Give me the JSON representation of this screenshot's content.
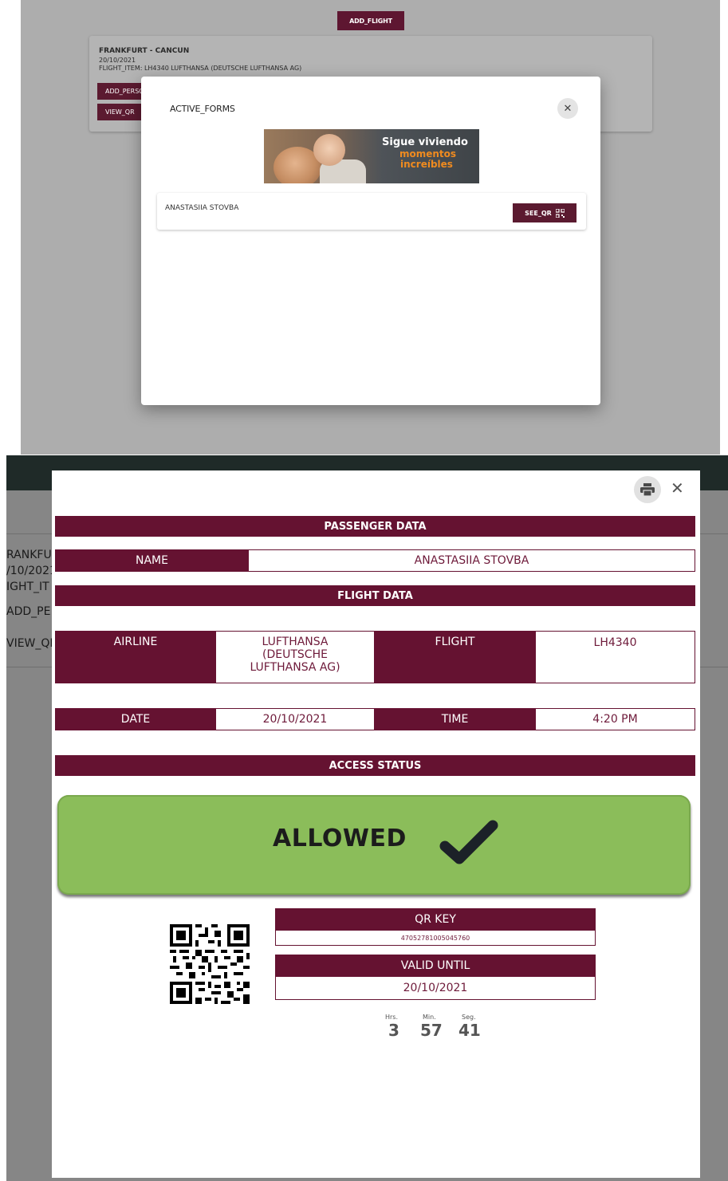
{
  "panel1": {
    "add_flight_label": "ADD_FLIGHT",
    "card": {
      "route": "FRANKFURT - CANCUN",
      "date": "20/10/2021",
      "flight_item": "FLIGHT_ITEM: LH4340 LUFTHANSA (DEUTSCHE LUFTHANSA AG)",
      "add_person_label": "ADD_PERSON",
      "view_qr_label": "VIEW_QR"
    },
    "modal": {
      "title": "ACTIVE_FORMS",
      "close_icon": "close-icon",
      "banner": {
        "line1": "Sigue viviendo",
        "line2": "momentos",
        "line3": "increíbles"
      },
      "form_row": {
        "passenger": "ANASTASIIA STOVBA",
        "see_qr_label": "SEE_QR",
        "qr_icon": "qr-code-icon"
      }
    }
  },
  "panel2": {
    "background_card": {
      "route_fragment": "RANKFU",
      "date_fragment": "/10/2021",
      "item_fragment": "IGHT_IT",
      "add_person_fragment": "ADD_PE",
      "view_qr_fragment": "VIEW_QF"
    },
    "modal": {
      "print_icon": "print-icon",
      "close_icon": "close-icon",
      "passenger_section": "PASSENGER DATA",
      "name_label": "NAME",
      "name_value": "ANASTASIIA STOVBA",
      "flight_section": "FLIGHT DATA",
      "airline_label": "AIRLINE",
      "airline_value": "LUFTHANSA (DEUTSCHE LUFTHANSA AG)",
      "flight_label": "FLIGHT",
      "flight_value": "LH4340",
      "date_label": "DATE",
      "date_value": "20/10/2021",
      "time_label": "TIME",
      "time_value": "4:20 PM",
      "access_section": "ACCESS STATUS",
      "access_status": "ALLOWED",
      "status_icon": "checkmark-icon",
      "status_color": "#8bbd5a",
      "qr_key_label": "QR KEY",
      "qr_key_value": "47052781005045760",
      "valid_until_label": "VALID UNTIL",
      "valid_until_value": "20/10/2021",
      "countdown": {
        "hours_label": "Hrs.",
        "hours": "3",
        "minutes_label": "Min.",
        "minutes": "57",
        "seconds_label": "Seg.",
        "seconds": "41"
      }
    }
  },
  "colors": {
    "brand": "#651231",
    "overlay": "#adadad",
    "allowed": "#8bbd5a"
  }
}
